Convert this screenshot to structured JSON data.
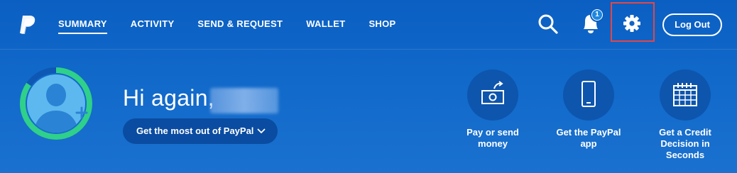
{
  "nav": {
    "logo": "paypal-logo",
    "tabs": [
      {
        "label": "SUMMARY",
        "active": true
      },
      {
        "label": "ACTIVITY",
        "active": false
      },
      {
        "label": "SEND & REQUEST",
        "active": false
      },
      {
        "label": "WALLET",
        "active": false
      },
      {
        "label": "SHOP",
        "active": false
      }
    ],
    "notification_count": "1",
    "logout_label": "Log Out"
  },
  "hero": {
    "greeting": "Hi again,",
    "cta_label": "Get the most out of PayPal"
  },
  "quick_actions": [
    {
      "icon": "send-money-icon",
      "label_lines": [
        "Pay or send",
        "money"
      ]
    },
    {
      "icon": "phone-icon",
      "label_lines": [
        "Get the PayPal",
        "app"
      ]
    },
    {
      "icon": "calendar-icon",
      "label_lines": [
        "Get a Credit",
        "Decision in",
        "Seconds"
      ]
    }
  ],
  "colors": {
    "background": "#0b5fc2",
    "accent_ring": "#2fd08a",
    "avatar": "#5db8ef",
    "highlight_box": "#e24747"
  }
}
